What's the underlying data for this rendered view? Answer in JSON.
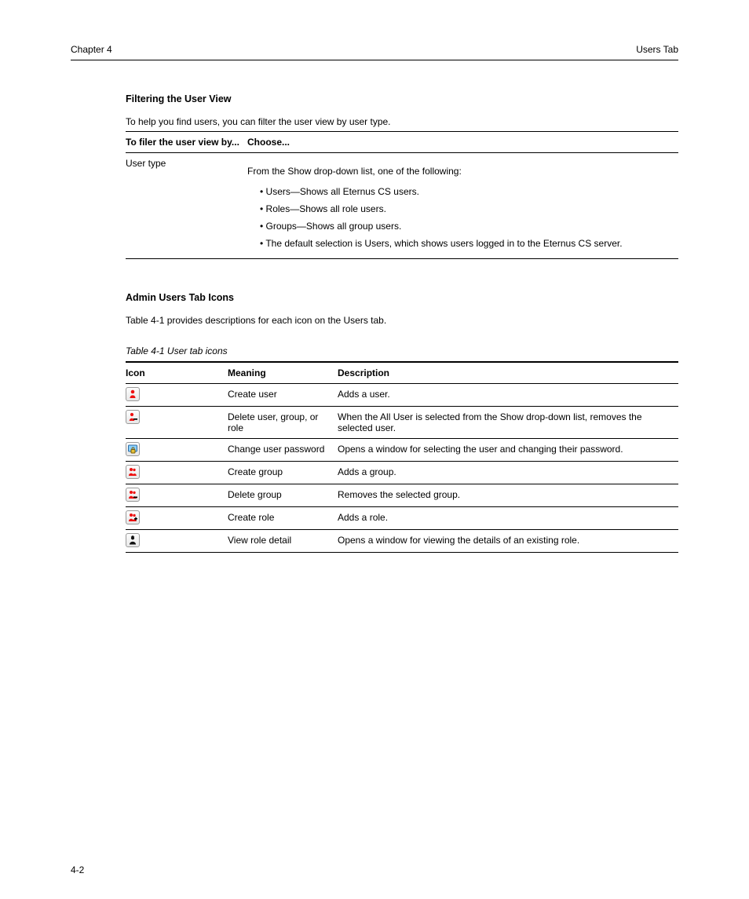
{
  "header": {
    "left": "Chapter 4",
    "right": "Users Tab"
  },
  "section1": {
    "title": "Filtering the User View",
    "intro": "To help you find users, you can filter the user view by user type.",
    "t_head_a": "To filer the user view by...",
    "t_head_b": "Choose...",
    "row_a": "User type",
    "row_b_line1": "From the Show drop-down list, one of the following:",
    "row_b_bullets": [
      "Users—Shows all Eternus CS users.",
      "Roles—Shows all role users.",
      "Groups—Shows all group users.",
      "The default selection is Users, which shows users logged in to the Eternus CS server."
    ]
  },
  "section2": {
    "title": "Admin Users Tab Icons",
    "intro": "Table 4-1 provides descriptions for each icon on the Users tab.",
    "caption": "Table 4-1  User tab icons",
    "t_head_icon": "Icon",
    "t_head_mean": "Meaning",
    "t_head_desc": "Description",
    "rows": [
      {
        "icon": "person",
        "mean": "Create user",
        "desc": "Adds a user."
      },
      {
        "icon": "person-minus",
        "mean": "Delete user, group, or role",
        "desc": "When the All User is selected from the Show drop-down list, removes the selected user."
      },
      {
        "icon": "lock",
        "mean": "Change user password",
        "desc": "Opens a window for selecting the user and changing their password."
      },
      {
        "icon": "people",
        "mean": "Create group",
        "desc": "Adds a group."
      },
      {
        "icon": "people-minus",
        "mean": "Delete group",
        "desc": "Removes the selected group."
      },
      {
        "icon": "people-plus",
        "mean": "Create role",
        "desc": "Adds a role."
      },
      {
        "icon": "role",
        "mean": "View role detail",
        "desc": "Opens a window for viewing the details of an existing role."
      }
    ]
  },
  "footer_page": "4-2"
}
